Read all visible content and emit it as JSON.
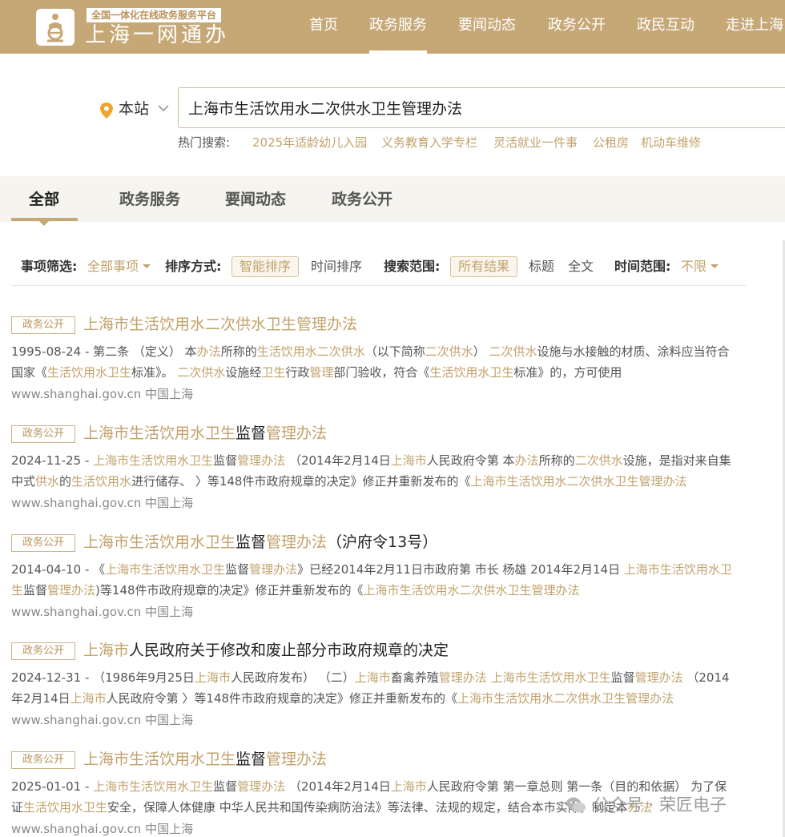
{
  "header": {
    "logo_sub": "全国一体化在线政务服务平台",
    "logo_main": "上海一网通办",
    "nav": [
      "首页",
      "政务服务",
      "要闻动态",
      "政务公开",
      "政民互动",
      "走进上海"
    ],
    "nav_active_index": 1
  },
  "search": {
    "location_label": "本站",
    "query": "上海市生活饮用水二次供水卫生管理办法",
    "hot_label": "热门搜索:",
    "hot_terms": [
      "2025年适龄幼儿入园",
      "义务教育入学专栏",
      "灵活就业一件事",
      "公租房",
      "机动车维修"
    ]
  },
  "tabs": [
    "全部",
    "政务服务",
    "要闻动态",
    "政务公开"
  ],
  "filters": {
    "category_label": "事项筛选:",
    "category_value": "全部事项",
    "sort_label": "排序方式:",
    "sort_smart": "智能排序",
    "sort_time": "时间排序",
    "scope_label": "搜索范围:",
    "scope_all": "所有结果",
    "scope_title": "标题",
    "scope_fulltext": "全文",
    "time_label": "时间范围:",
    "time_value": "不限"
  },
  "results": [
    {
      "tag": "政务公开",
      "title": [
        {
          "t": "上海市生活饮用水二次供水卫生管理办法",
          "hl": true
        }
      ],
      "desc": [
        {
          "t": "1995-08-24 - 第二条 （定义） 本",
          "hl": false
        },
        {
          "t": "办法",
          "hl": true
        },
        {
          "t": "所称的",
          "hl": false
        },
        {
          "t": "生活饮用水二次供水",
          "hl": true
        },
        {
          "t": "（以下简称",
          "hl": false
        },
        {
          "t": "二次供水",
          "hl": true
        },
        {
          "t": "） ",
          "hl": false
        },
        {
          "t": "二次供水",
          "hl": true
        },
        {
          "t": "设施与水接触的材质、涂料应当符合国家《",
          "hl": false
        },
        {
          "t": "生活饮用水卫生",
          "hl": true
        },
        {
          "t": "标准》。 ",
          "hl": false
        },
        {
          "t": "二次供水",
          "hl": true
        },
        {
          "t": "设施经",
          "hl": false
        },
        {
          "t": "卫生",
          "hl": true
        },
        {
          "t": "行政",
          "hl": false
        },
        {
          "t": "管理",
          "hl": true
        },
        {
          "t": "部门验收，符合《",
          "hl": false
        },
        {
          "t": "生活饮用水卫生",
          "hl": true
        },
        {
          "t": "标准》的，方可使用",
          "hl": false
        }
      ],
      "url": "www.shanghai.gov.cn  中国上海"
    },
    {
      "tag": "政务公开",
      "title": [
        {
          "t": "上海市生活饮用水卫生",
          "hl": true
        },
        {
          "t": "监督",
          "hl": false
        },
        {
          "t": "管理办法",
          "hl": true
        }
      ],
      "desc": [
        {
          "t": "2024-11-25 - ",
          "hl": false
        },
        {
          "t": "上海市生活饮用水卫生",
          "hl": true
        },
        {
          "t": "监督",
          "hl": false
        },
        {
          "t": "管理办法",
          "hl": true
        },
        {
          "t": " （2014年2月14日",
          "hl": false
        },
        {
          "t": "上海市",
          "hl": true
        },
        {
          "t": "人民政府令第 本",
          "hl": false
        },
        {
          "t": "办法",
          "hl": true
        },
        {
          "t": "所称的",
          "hl": false
        },
        {
          "t": "二次供水",
          "hl": true
        },
        {
          "t": "设施，是指对来自集中式",
          "hl": false
        },
        {
          "t": "供水",
          "hl": true
        },
        {
          "t": "的",
          "hl": false
        },
        {
          "t": "生活饮用水",
          "hl": true
        },
        {
          "t": "进行储存、 〉等148件市政府规章的决定》修正并重新发布的《",
          "hl": false
        },
        {
          "t": "上海市生活饮用水二次供水卫生管理办法",
          "hl": true
        }
      ],
      "url": "www.shanghai.gov.cn  中国上海"
    },
    {
      "tag": "政务公开",
      "title": [
        {
          "t": "上海市生活饮用水卫生",
          "hl": true
        },
        {
          "t": "监督",
          "hl": false
        },
        {
          "t": "管理办法",
          "hl": true
        },
        {
          "t": "（沪府令13号）",
          "hl": false
        }
      ],
      "desc": [
        {
          "t": "2014-04-10 - 《",
          "hl": false
        },
        {
          "t": "上海市生活饮用水卫生",
          "hl": true
        },
        {
          "t": "监督",
          "hl": false
        },
        {
          "t": "管理办法",
          "hl": true
        },
        {
          "t": "》已经2014年2月11日市政府第 市长 杨雄 2014年2月14日 ",
          "hl": false
        },
        {
          "t": "上海市生活饮用水卫生",
          "hl": true
        },
        {
          "t": "监督",
          "hl": false
        },
        {
          "t": "管理办法",
          "hl": true
        },
        {
          "t": ")等148件市政府规章的决定》修正并重新发布的《",
          "hl": false
        },
        {
          "t": "上海市生活饮用水二次供水卫生管理办法",
          "hl": true
        }
      ],
      "url": "www.shanghai.gov.cn  中国上海"
    },
    {
      "tag": "政务公开",
      "title": [
        {
          "t": "上海市",
          "hl": true
        },
        {
          "t": "人民政府关于修改和废止部分市政府规章的决定",
          "hl": false
        }
      ],
      "desc": [
        {
          "t": "2024-12-31 - （1986年9月25日",
          "hl": false
        },
        {
          "t": "上海市",
          "hl": true
        },
        {
          "t": "人民政府发布） （二）",
          "hl": false
        },
        {
          "t": "上海市",
          "hl": true
        },
        {
          "t": "畜禽养殖",
          "hl": false
        },
        {
          "t": "管理办法",
          "hl": true
        },
        {
          "t": " ",
          "hl": false
        },
        {
          "t": "上海市生活饮用水卫生",
          "hl": true
        },
        {
          "t": "监督",
          "hl": false
        },
        {
          "t": "管理办法",
          "hl": true
        },
        {
          "t": " （2014年2月14日",
          "hl": false
        },
        {
          "t": "上海市",
          "hl": true
        },
        {
          "t": "人民政府令第 〉等148件市政府规章的决定》修正并重新发布的《",
          "hl": false
        },
        {
          "t": "上海市生活饮用水二次供水卫生管理办法",
          "hl": true
        }
      ],
      "url": "www.shanghai.gov.cn  中国上海"
    },
    {
      "tag": "政务公开",
      "title": [
        {
          "t": "上海市生活饮用水卫生",
          "hl": true
        },
        {
          "t": "监督",
          "hl": false
        },
        {
          "t": "管理办法",
          "hl": true
        }
      ],
      "desc": [
        {
          "t": "2025-01-01 - ",
          "hl": false
        },
        {
          "t": "上海市生活饮用水卫生",
          "hl": true
        },
        {
          "t": "监督",
          "hl": false
        },
        {
          "t": "管理办法",
          "hl": true
        },
        {
          "t": " （2014年2月14日",
          "hl": false
        },
        {
          "t": "上海市",
          "hl": true
        },
        {
          "t": "人民政府令第 第一章总则 第一条（目的和依据） 为了保证",
          "hl": false
        },
        {
          "t": "生活饮用水卫生",
          "hl": true
        },
        {
          "t": "安全，保障人体健康 中华人民共和国传染病防治法》等法律、法规的规定，结合本市实际，制定本",
          "hl": false
        },
        {
          "t": "办法",
          "hl": true
        }
      ],
      "url": "www.shanghai.gov.cn  中国上海"
    }
  ],
  "watermark": "公众号 · 荣匠电子",
  "colors": {
    "brand": "#c6a877",
    "highlight": "#c2a26c"
  }
}
